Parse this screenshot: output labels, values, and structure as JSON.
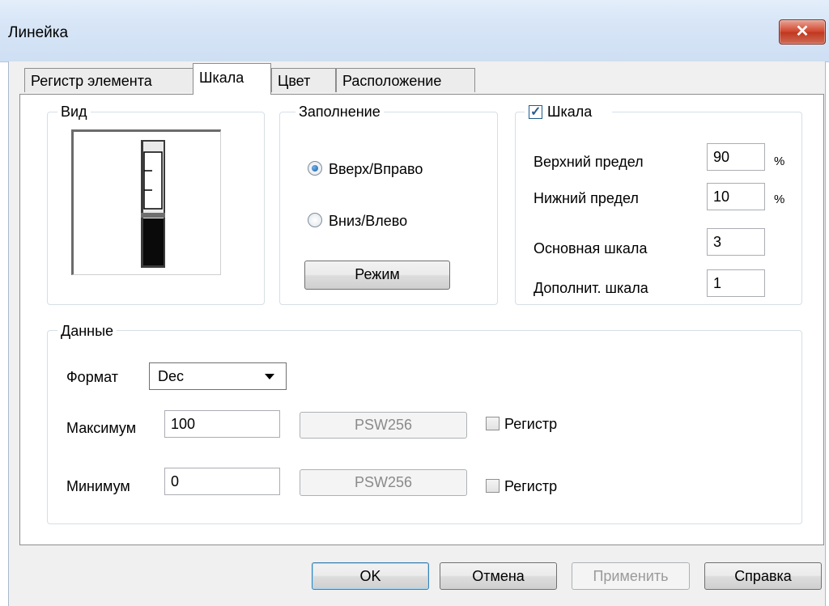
{
  "window": {
    "title": "Линейка",
    "close_glyph": "✕"
  },
  "tabs": [
    {
      "label": "Регистр элемента",
      "active": false
    },
    {
      "label": "Шкала",
      "active": true
    },
    {
      "label": "Цвет",
      "active": false
    },
    {
      "label": "Расположение",
      "active": false
    }
  ],
  "view_group": {
    "title": "Вид"
  },
  "fill_group": {
    "title": "Заполнение",
    "options": [
      {
        "label": "Вверх/Вправо",
        "selected": true
      },
      {
        "label": "Вниз/Влево",
        "selected": false
      }
    ],
    "mode_button": "Режим"
  },
  "scale_group": {
    "title": "Шкала",
    "checked": true,
    "upper_limit_label": "Верхний предел",
    "upper_limit_value": "90",
    "lower_limit_label": "Нижний предел",
    "lower_limit_value": "10",
    "percent_sign": "%",
    "major_scale_label": "Основная шкала",
    "major_scale_value": "3",
    "minor_scale_label": "Дополнит. шкала",
    "minor_scale_value": "1"
  },
  "data_group": {
    "title": "Данные",
    "format_label": "Формат",
    "format_value": "Dec",
    "max_label": "Максимум",
    "max_value": "100",
    "max_register_button": "PSW256",
    "max_register_checkbox": "Регистр",
    "min_label": "Минимум",
    "min_value": "0",
    "min_register_button": "PSW256",
    "min_register_checkbox": "Регистр"
  },
  "footer": {
    "ok": "OK",
    "cancel": "Отмена",
    "apply": "Применить",
    "help": "Справка"
  },
  "colors": {
    "titlebar": "#d7e5f7",
    "close_button": "#c94a34",
    "window_bg": "#f0f0f0"
  },
  "icons": {
    "close": "close-icon",
    "check": "checkmark-icon",
    "dropdown": "chevron-down-icon"
  }
}
